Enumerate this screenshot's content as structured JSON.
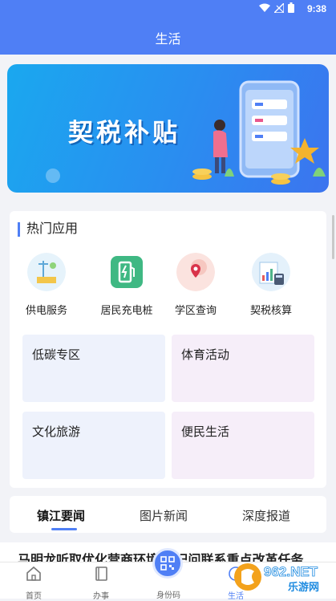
{
  "status_bar": {
    "time": "9:38"
  },
  "header": {
    "title": "生活"
  },
  "banner": {
    "title": "契税补贴"
  },
  "hot_apps": {
    "title": "热门应用",
    "items": [
      {
        "label": "供电服务",
        "icon": "power-service-icon"
      },
      {
        "label": "居民充电桩",
        "icon": "charging-pile-icon"
      },
      {
        "label": "学区查询",
        "icon": "school-district-icon"
      },
      {
        "label": "契税核算",
        "icon": "tax-calculator-icon"
      }
    ]
  },
  "tiles": [
    {
      "label": "低碳专区"
    },
    {
      "label": "体育活动"
    },
    {
      "label": "文化旅游"
    },
    {
      "label": "便民生活"
    }
  ],
  "news_tabs": [
    {
      "label": "镇江要闻",
      "active": true
    },
    {
      "label": "图片新闻",
      "active": false
    },
    {
      "label": "深度报道",
      "active": false
    }
  ],
  "news_peek": "马明龙听取优化营商环境      书记问联系重点改革任务",
  "bottom_nav": [
    {
      "label": "首页",
      "icon": "home-icon"
    },
    {
      "label": "办事",
      "icon": "book-icon"
    },
    {
      "label": "身份码",
      "icon": "qr-code-icon"
    },
    {
      "label": "生活",
      "icon": "life-icon"
    }
  ],
  "watermark": {
    "text": "962.NET",
    "subtext": "乐游网"
  },
  "colors": {
    "primary": "#4f7ff5",
    "tile_blue": "#eef2fc",
    "tile_pink": "#f6eef9"
  }
}
